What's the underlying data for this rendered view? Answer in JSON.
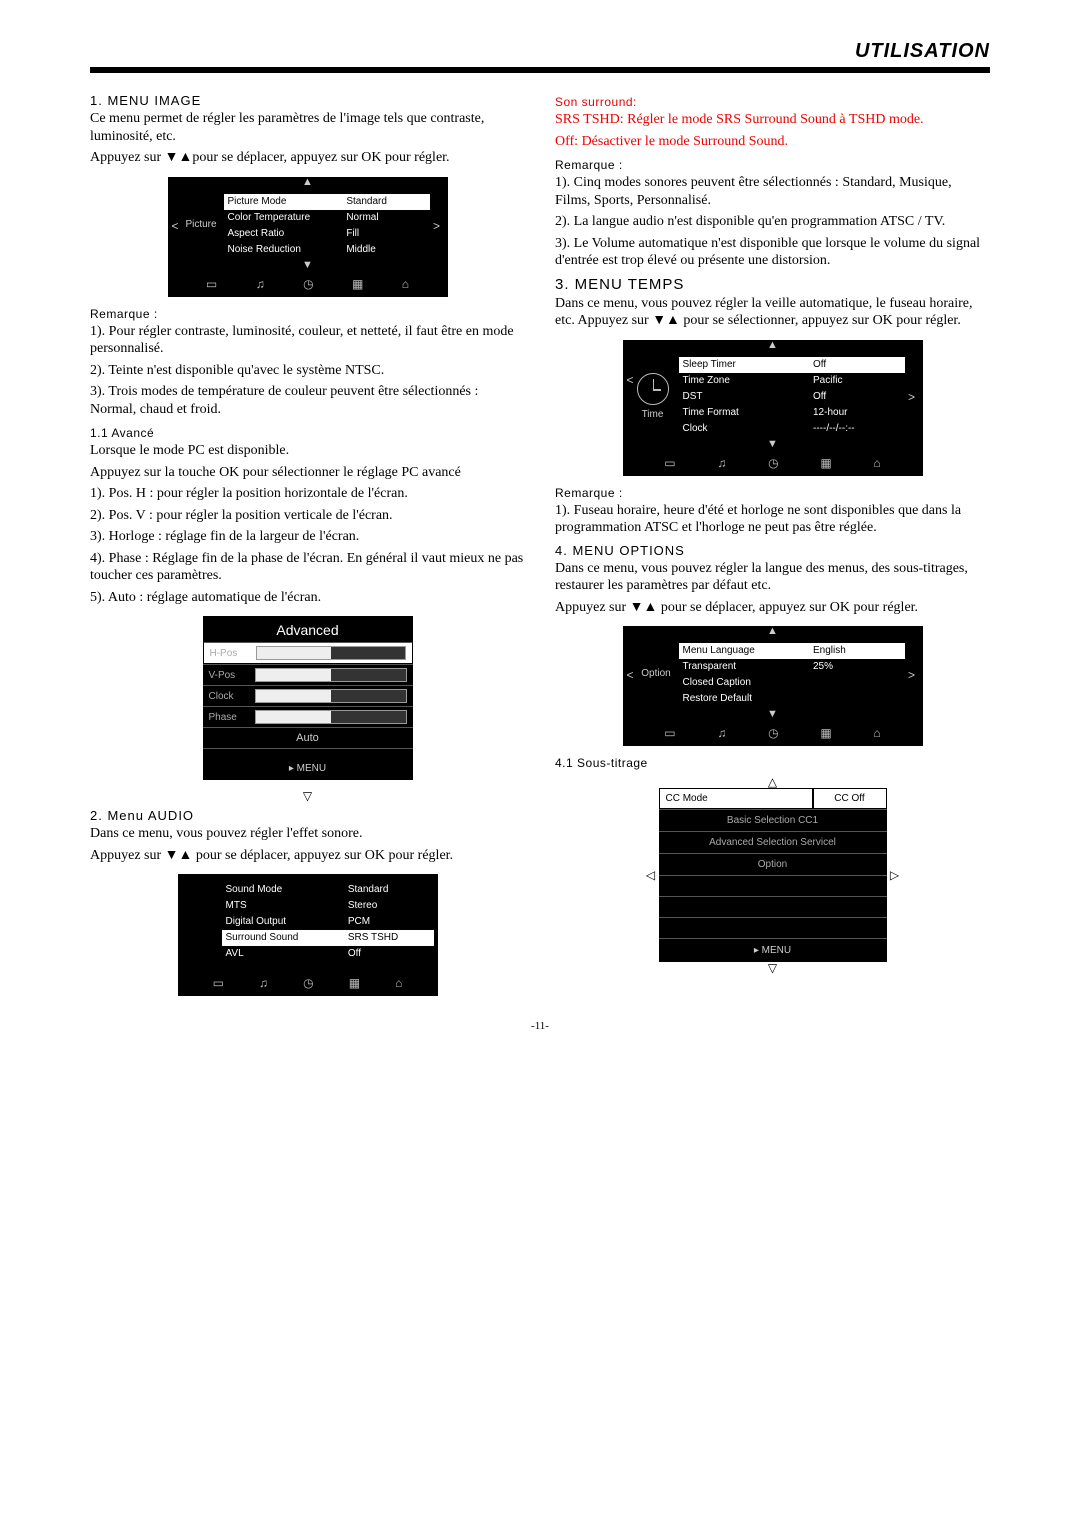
{
  "header": {
    "title": "UTILISATION"
  },
  "page_number": "-11-",
  "left": {
    "s1_title": "1. MENU IMAGE",
    "s1_p1": "Ce menu permet de régler les paramètres de l'image tels que contraste, luminosité, etc.",
    "s1_p2_a": "Appuyez sur ",
    "s1_p2_b": "▼▲",
    "s1_p2_c": "pour se déplacer, appuyez sur OK pour régler.",
    "osd_picture": {
      "tab": "Picture",
      "rows": [
        {
          "l": "Picture Mode",
          "r": "Standard",
          "hl": true
        },
        {
          "l": "Color Temperature",
          "r": "Normal"
        },
        {
          "l": "Aspect Ratio",
          "r": "Fill"
        },
        {
          "l": "Noise Reduction",
          "r": "Middle"
        }
      ]
    },
    "remark1_title": "Remarque :",
    "remark1_1": "1). Pour régler contraste, luminosité, couleur, et netteté, il faut être en mode personnalisé.",
    "remark1_2": "2). Teinte n'est disponible qu'avec le système NTSC.",
    "remark1_3": "3). Trois modes de température de couleur peuvent être sélectionnés : Normal, chaud et froid.",
    "s11_title": "1.1 Avancé",
    "s11_p1": "Lorsque le mode PC est disponible.",
    "s11_p2": "Appuyez sur la touche OK pour sélectionner le réglage PC avancé",
    "s11_l1": "1). Pos. H : pour régler la position horizontale de l'écran.",
    "s11_l2": "2). Pos. V : pour régler la position verticale de l'écran.",
    "s11_l3": "3). Horloge : réglage fin de la largeur de l'écran.",
    "s11_l4": "4). Phase : Réglage fin de la phase de l'écran. En général il vaut mieux ne pas toucher ces paramètres.",
    "s11_l5": "5). Auto : réglage automatique de l'écran.",
    "osd_advanced": {
      "head": "Advanced",
      "rows": [
        "H-Pos",
        "V-Pos",
        "Clock",
        "Phase"
      ],
      "auto": "Auto",
      "menu": "MENU"
    },
    "s2_title": "2. Menu AUDIO",
    "s2_p1": "Dans ce menu, vous pouvez régler l'effet sonore.",
    "s2_p2_a": "Appuyez sur ",
    "s2_p2_b": "▼▲",
    "s2_p2_c": " pour se déplacer, appuyez sur OK pour régler.",
    "osd_sound": {
      "rows": [
        {
          "l": "Sound Mode",
          "r": "Standard"
        },
        {
          "l": "MTS",
          "r": "Stereo"
        },
        {
          "l": "Digital Output",
          "r": "PCM"
        },
        {
          "l": "Surround Sound",
          "r": "SRS TSHD",
          "hl": true
        },
        {
          "l": "AVL",
          "r": "Off"
        }
      ]
    }
  },
  "right": {
    "surround_title": "Son surround:",
    "surround_l1": "SRS TSHD: Régler le mode SRS Surround Sound à TSHD mode.",
    "surround_l2": "Off: Désactiver le mode Surround Sound.",
    "remark2_title": "Remarque :",
    "remark2_1": "1). Cinq modes sonores peuvent être sélectionnés : Standard, Musique, Films, Sports, Personnalisé.",
    "remark2_2": "2). La langue audio n'est disponible qu'en programmation ATSC / TV.",
    "remark2_3": "3). Le Volume automatique n'est disponible que lorsque le volume du signal d'entrée est trop élevé ou présente une distorsion.",
    "s3_title": "3. MENU TEMPS",
    "s3_p1_a": "Dans ce menu, vous pouvez régler la veille automatique, le fuseau horaire, etc. Appuyez sur ",
    "s3_p1_b": "▼▲",
    "s3_p1_c": " pour se sélectionner, appuyez sur OK pour régler.",
    "osd_time": {
      "tab": "Time",
      "rows": [
        {
          "l": "Sleep Timer",
          "r": "Off",
          "hl": true
        },
        {
          "l": "Time Zone",
          "r": "Pacific"
        },
        {
          "l": "DST",
          "r": "Off"
        },
        {
          "l": "Time Format",
          "r": "12-hour"
        },
        {
          "l": "Clock",
          "r": "----/--/--:--"
        }
      ]
    },
    "remark3_title": "Remarque :",
    "remark3_1": "1). Fuseau horaire, heure d'été et horloge ne sont disponibles que dans la programmation ATSC et l'horloge ne peut pas être réglée.",
    "s4_title": "4. MENU OPTIONS",
    "s4_p1": "Dans ce menu, vous pouvez régler la langue des menus, des sous-titrages, restaurer les paramètres par défaut etc.",
    "s4_p2_a": "Appuyez sur ",
    "s4_p2_b": "▼▲",
    "s4_p2_c": " pour se déplacer, appuyez sur OK pour régler.",
    "osd_option": {
      "tab": "Option",
      "rows": [
        {
          "l": "Menu Language",
          "r": "English",
          "hl": true
        },
        {
          "l": "Transparent",
          "r": "25%"
        },
        {
          "l": "Closed Caption",
          "r": ""
        },
        {
          "l": "Restore Default",
          "r": ""
        }
      ]
    },
    "s41_title": "4.1 Sous-titrage",
    "osd_cc": {
      "head_l": "CC Mode",
      "head_r": "CC Off",
      "rows": [
        "Basic Selection CC1",
        "Advanced Selection Servicel",
        "Option"
      ],
      "menu": "MENU"
    }
  }
}
